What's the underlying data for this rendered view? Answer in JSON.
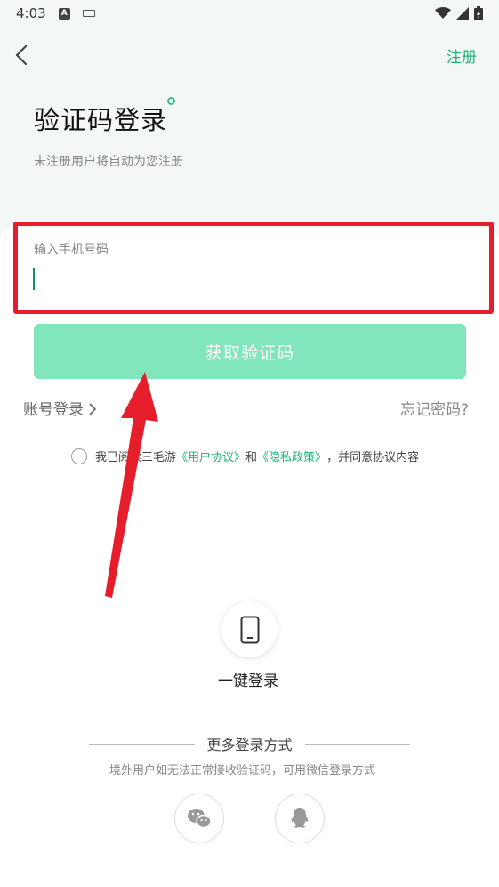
{
  "status_bar": {
    "time": "4:03",
    "a_badge": "A"
  },
  "nav": {
    "register": "注册"
  },
  "header": {
    "title": "验证码登录",
    "subtitle": "未注册用户将自动为您注册"
  },
  "phone": {
    "label": "输入手机号码",
    "value": ""
  },
  "get_code_button": "获取验证码",
  "account_login": "账号登录",
  "forgot_password": "忘记密码?",
  "agreement": {
    "prefix": "我已阅读三毛游",
    "user_agreement": "《用户协议》",
    "and": "和",
    "privacy_policy": "《隐私政策》",
    "suffix": "，并同意协议内容"
  },
  "one_click": {
    "label": "一键登录",
    "icon": "phone-icon"
  },
  "more": {
    "title": "更多登录方式",
    "note": "境外用户如无法正常接收验证码，可用微信登录方式"
  },
  "social": [
    {
      "name": "wechat",
      "icon": "wechat-icon"
    },
    {
      "name": "qq",
      "icon": "qq-icon"
    }
  ],
  "colors": {
    "accent": "#1fb37a",
    "button": "#82e6bd",
    "highlight": "#e61e2b"
  }
}
